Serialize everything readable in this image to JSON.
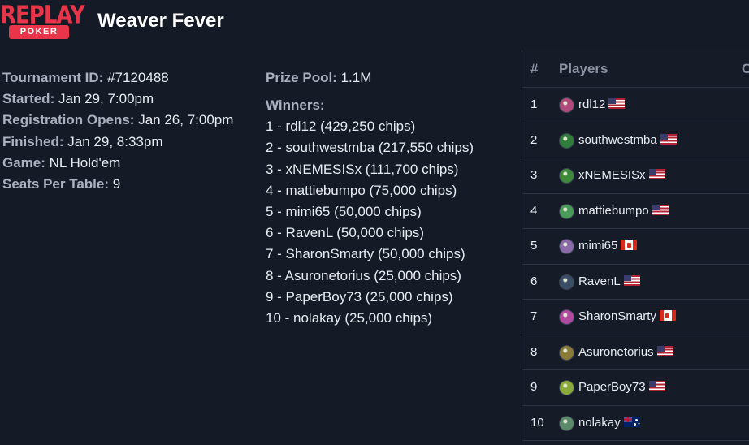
{
  "brand": {
    "logo_top": "REPLAY",
    "logo_bottom": "POKER",
    "accent": "#e8354a"
  },
  "title": "Weaver Fever",
  "info": [
    {
      "label": "Tournament ID:",
      "value": "#7120488"
    },
    {
      "label": "Started:",
      "value": "Jan 29, 7:00pm"
    },
    {
      "label": "Registration Opens:",
      "value": "Jan 26, 7:00pm"
    },
    {
      "label": "Finished:",
      "value": "Jan 29, 8:33pm"
    },
    {
      "label": "Game:",
      "value": "NL Hold'em"
    },
    {
      "label": "Seats Per Table:",
      "value": "9"
    }
  ],
  "prize": {
    "label": "Prize Pool:",
    "value": "1.1M"
  },
  "winners": {
    "label": "Winners:",
    "items": [
      "1 - rdl12 (429,250 chips)",
      "2 - southwestmba (217,550 chips)",
      "3 - xNEMESISx (111,700 chips)",
      "4 - mattiebumpo (75,000 chips)",
      "5 - mimi65 (50,000 chips)",
      "6 - RavenL (50,000 chips)",
      "7 - SharonSmarty (50,000 chips)",
      "8 - Asuronetorius (25,000 chips)",
      "9 - PaperBoy73 (25,000 chips)",
      "10 - nolakay (25,000 chips)"
    ]
  },
  "table": {
    "headers": {
      "rank": "#",
      "players": "Players",
      "third": "C"
    },
    "rows": [
      {
        "rank": "1",
        "name": "rdl12",
        "flag": "us",
        "avatar": "#b04a7a"
      },
      {
        "rank": "2",
        "name": "southwestmba",
        "flag": "us",
        "avatar": "#2e7d3a"
      },
      {
        "rank": "3",
        "name": "xNEMESISx",
        "flag": "us",
        "avatar": "#3d8a3a"
      },
      {
        "rank": "4",
        "name": "mattiebumpo",
        "flag": "us",
        "avatar": "#4a9a5a"
      },
      {
        "rank": "5",
        "name": "mimi65",
        "flag": "ca",
        "avatar": "#8a6aa8"
      },
      {
        "rank": "6",
        "name": "RavenL",
        "flag": "us",
        "avatar": "#3a4e66"
      },
      {
        "rank": "7",
        "name": "SharonSmarty",
        "flag": "ca",
        "avatar": "#b04aa0"
      },
      {
        "rank": "8",
        "name": "Asuronetorius",
        "flag": "us",
        "avatar": "#8a7a3a"
      },
      {
        "rank": "9",
        "name": "PaperBoy73",
        "flag": "us",
        "avatar": "#8aaa3a"
      },
      {
        "rank": "10",
        "name": "nolakay",
        "flag": "au",
        "avatar": "#5a8a6a"
      }
    ]
  }
}
